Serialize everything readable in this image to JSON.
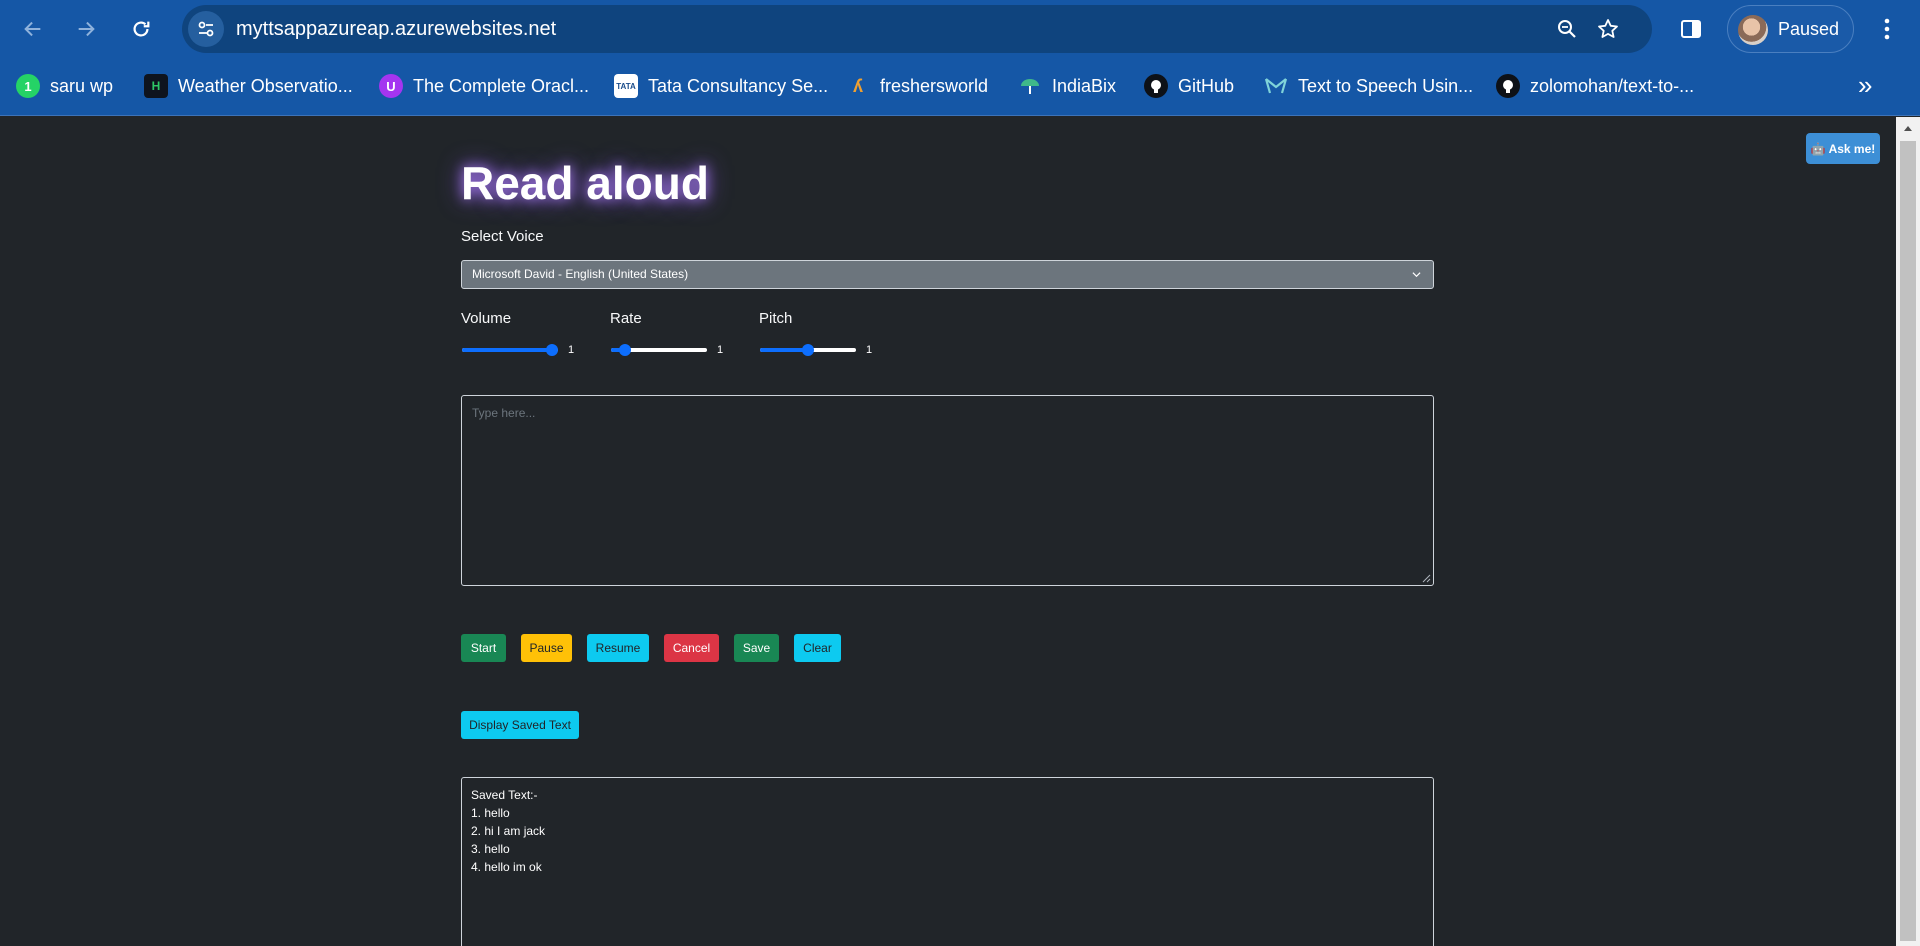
{
  "browser": {
    "url": "myttsappazureap.azurewebsites.net",
    "profile_label": "Paused",
    "bookmarks": [
      {
        "label": "saru wp",
        "icon": "whatsapp-icon"
      },
      {
        "label": "Weather Observatio...",
        "icon": "hackerrank-icon"
      },
      {
        "label": "The Complete Oracl...",
        "icon": "udemy-icon"
      },
      {
        "label": "Tata Consultancy Se...",
        "icon": "tata-icon"
      },
      {
        "label": "freshersworld",
        "icon": "freshersworld-icon"
      },
      {
        "label": "IndiaBix",
        "icon": "indiabix-icon"
      },
      {
        "label": "GitHub",
        "icon": "github-icon"
      },
      {
        "label": "Text to Speech Usin...",
        "icon": "mailjet-icon"
      },
      {
        "label": "zolomohan/text-to-...",
        "icon": "github-icon"
      }
    ]
  },
  "page": {
    "ask_label": "🤖 Ask me!",
    "title": "Read aloud",
    "select_voice_label": "Select Voice",
    "voice_selected": "Microsoft David - English (United States)",
    "controls": [
      {
        "label": "Volume",
        "value": "1",
        "level": 1.0
      },
      {
        "label": "Rate",
        "value": "1",
        "level": 0.1
      },
      {
        "label": "Pitch",
        "value": "1",
        "level": 0.5
      }
    ],
    "textarea_placeholder": "Type here...",
    "buttons": {
      "start": "Start",
      "pause": "Pause",
      "resume": "Resume",
      "cancel": "Cancel",
      "save": "Save",
      "clear": "Clear"
    },
    "display_saved_label": "Display Saved Text",
    "saved_text": {
      "heading": "Saved Text:-",
      "items": [
        "1. hello",
        "2. hi I am jack",
        "3. hello",
        "4. hello im ok"
      ]
    }
  },
  "colors": {
    "chrome_bg": "#1557a6",
    "page_bg": "#212529",
    "success": "#198754",
    "warning": "#ffc107",
    "info": "#0dcaf0",
    "danger": "#dc3545",
    "slider": "#0d6efd"
  }
}
